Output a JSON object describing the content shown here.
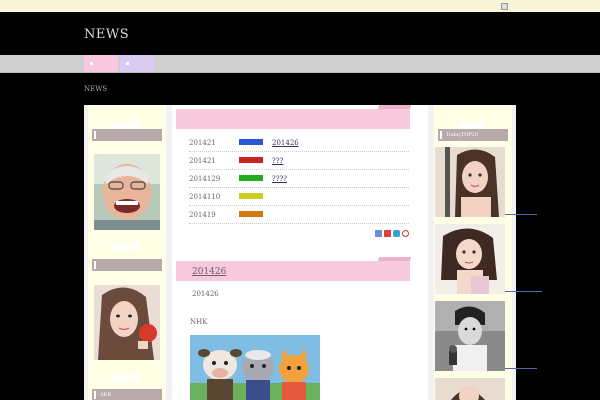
{
  "header": {
    "site_title": "NEWS"
  },
  "breadcrumb": "NEWS",
  "left_sidebar": {
    "widget3_title": "AKB"
  },
  "right_sidebar": {
    "ranking_title": "TodayTOP20"
  },
  "news_list": [
    {
      "date": "201421",
      "color": "#2a57d6",
      "link": "201426"
    },
    {
      "date": "201421",
      "color": "#cc2222",
      "link": "???"
    },
    {
      "date": "2014129",
      "color": "#22aa22",
      "link": "????"
    },
    {
      "date": "2014110",
      "color": "#cccc22",
      "link": ""
    },
    {
      "date": "201419",
      "color": "#d27a11",
      "link": ""
    }
  ],
  "article": {
    "title": "201426",
    "date": "201426",
    "source": "NHK"
  },
  "colors": {
    "accent_pink": "#f8c8dc",
    "sidebar_cream": "#ffffe6",
    "title_grey": "#b8aaaa"
  },
  "icons": [
    "bookmark-icon",
    "hatena-icon",
    "delicious-icon",
    "share-icon"
  ]
}
